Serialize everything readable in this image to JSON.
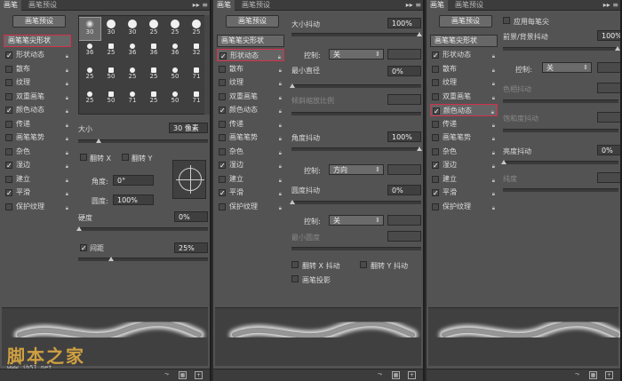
{
  "tabs": {
    "brush": "画笔",
    "brush_presets": "画笔预设",
    "menu": "▸▸ ≡"
  },
  "preset_button": "画笔预设",
  "brush_tip_header": "画笔笔尖形状",
  "options": [
    {
      "label": "形状动态",
      "checked": true
    },
    {
      "label": "散布",
      "checked": false
    },
    {
      "label": "纹理",
      "checked": false
    },
    {
      "label": "双重画笔",
      "checked": false
    },
    {
      "label": "颜色动态",
      "checked": true
    },
    {
      "label": "传递",
      "checked": false
    },
    {
      "label": "画笔笔势",
      "checked": false
    },
    {
      "label": "杂色",
      "checked": false
    },
    {
      "label": "湿边",
      "checked": true
    },
    {
      "label": "建立",
      "checked": false
    },
    {
      "label": "平滑",
      "checked": true
    },
    {
      "label": "保护纹理",
      "checked": false
    }
  ],
  "brush_grid": {
    "rows": [
      [
        "30",
        "30",
        "30",
        "25",
        "25",
        "25"
      ],
      [
        "36",
        "25",
        "36",
        "36",
        "36",
        "32"
      ],
      [
        "25",
        "50",
        "25",
        "25",
        "50",
        "71"
      ],
      [
        "25",
        "50",
        "71",
        "25",
        "50",
        "71"
      ]
    ]
  },
  "panel1": {
    "size_label": "大小",
    "size_value": "30 像素",
    "flip_x": "翻转 X",
    "flip_y": "翻转 Y",
    "angle_label": "角度:",
    "angle_value": "0°",
    "roundness_label": "圆度:",
    "roundness_value": "100%",
    "hardness_label": "硬度",
    "hardness_value": "0%",
    "spacing_label": "间距",
    "spacing_value": "25%",
    "spacing_checked": "✓"
  },
  "panel2": {
    "size_jitter_label": "大小抖动",
    "size_jitter_value": "100%",
    "control_label": "控制:",
    "control_value_1": "关",
    "min_diameter_label": "最小直径",
    "min_diameter_value": "0%",
    "tilt_scale_label": "倾斜缩放比例",
    "angle_jitter_label": "角度抖动",
    "angle_jitter_value": "100%",
    "control_value_2": "方向",
    "roundness_jitter_label": "圆度抖动",
    "roundness_jitter_value": "0%",
    "control_value_3": "关",
    "min_roundness_label": "最小圆度",
    "flip_x_jitter": "翻转 X 抖动",
    "flip_y_jitter": "翻转 Y 抖动",
    "brush_projection": "画笔投影"
  },
  "panel3": {
    "apply_per_tip": "应用每笔尖",
    "fg_bg_jitter_label": "前景/背景抖动",
    "fg_bg_jitter_value": "100%",
    "control_label": "控制:",
    "control_value": "关",
    "hue_jitter_label": "色相抖动",
    "saturation_jitter_label": "饱和度抖动",
    "brightness_jitter_label": "亮度抖动",
    "brightness_jitter_value": "0%",
    "purity_label": "纯度"
  },
  "watermark": {
    "text": "脚本之家",
    "url": "www.jb51.net"
  },
  "colors": {
    "highlight": "#d3314a",
    "panel_bg": "#535353"
  }
}
